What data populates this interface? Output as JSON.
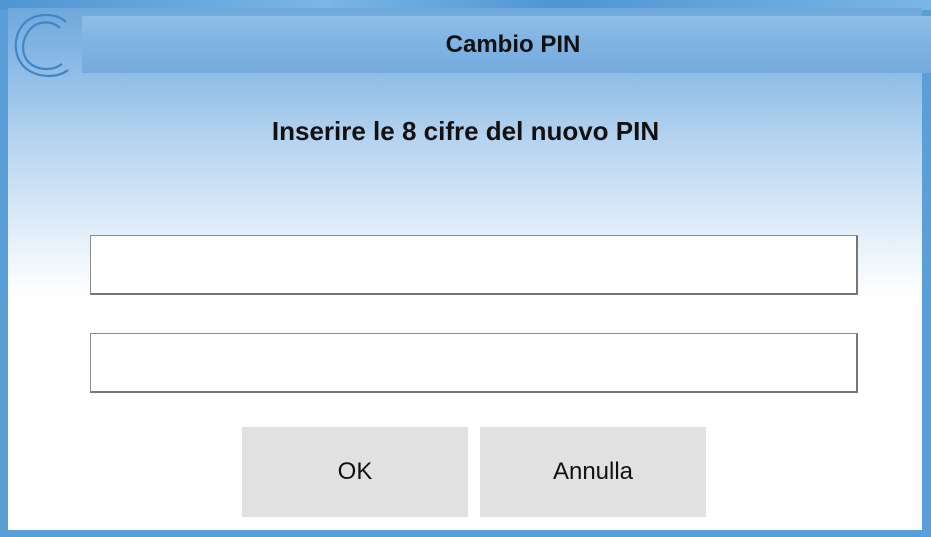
{
  "dialog": {
    "title": "Cambio PIN",
    "prompt": "Inserire le 8 cifre del nuovo PIN",
    "logo_icon": "c-logo-icon"
  },
  "fields": [
    {
      "value": "",
      "placeholder": ""
    },
    {
      "value": "",
      "placeholder": ""
    }
  ],
  "buttons": {
    "ok_label": "OK",
    "cancel_label": "Annulla"
  },
  "colors": {
    "title_bar": "#7fb3e2",
    "logo_stroke": "#3f86c8",
    "button_bg": "#e1e1e1"
  }
}
